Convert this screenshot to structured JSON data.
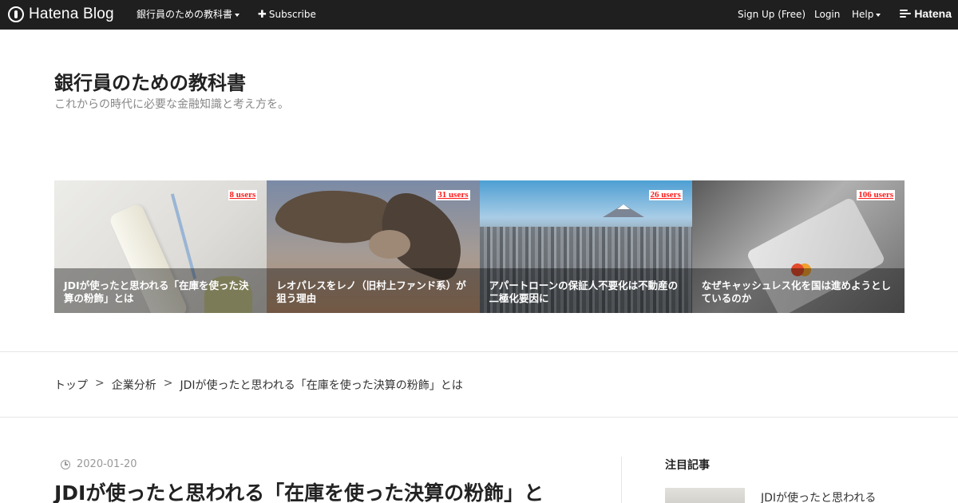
{
  "topbar": {
    "logo_text": "Hatena Blog",
    "blog_menu": "銀行員のための教科書",
    "subscribe": "Subscribe",
    "signup": "Sign Up (Free)",
    "login": "Login",
    "help": "Help",
    "brand": "Hatena",
    "background_color": "#1f1f1f"
  },
  "blog": {
    "title": "銀行員のための教科書",
    "description": "これからの時代に必要な金融知識と考え方を。"
  },
  "featured": [
    {
      "title": "JDIが使ったと思われる「在庫を使った決算の粉飾」とは",
      "users": "8 users",
      "image": "paint-roller"
    },
    {
      "title": "レオパレスをレノ（旧村上ファンド系）が狙う理由",
      "users": "31 users",
      "image": "vulture"
    },
    {
      "title": "アパートローンの保証人不要化は不動産の二極化要因に",
      "users": "26 users",
      "image": "tokyo-skyline"
    },
    {
      "title": "なぜキャッシュレス化を国は進めようとしているのか",
      "users": "106 users",
      "image": "credit-card"
    }
  ],
  "breadcrumb": {
    "items": [
      "トップ",
      "企業分析"
    ],
    "separator": ">",
    "current": "JDIが使ったと思われる「在庫を使った決算の粉飾」とは"
  },
  "article": {
    "date": "2020-01-20",
    "title": "JDIが使ったと思われる「在庫を使った決算の粉飾」と"
  },
  "sidebar": {
    "heading": "注目記事",
    "first_item": "JDIが使ったと思われる"
  },
  "colors": {
    "users_badge": "#ff1a1a",
    "divider": "#e5e5e5"
  }
}
